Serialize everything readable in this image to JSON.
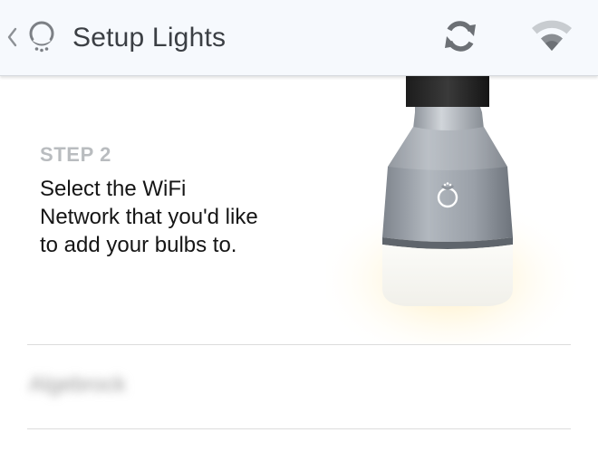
{
  "appbar": {
    "title": "Setup Lights",
    "icons": {
      "back": "chevron-left-icon",
      "logo": "bulb-logo-icon",
      "refresh": "refresh-icon",
      "wifi": "wifi-icon"
    }
  },
  "step": {
    "label": "STEP 2",
    "instruction": "Select the WiFi Network that you'd like to add your bulbs to."
  },
  "networks": [
    {
      "name": "Algebrock"
    }
  ],
  "colors": {
    "appbar_background": "#f6f9fd",
    "title_text": "#3b3f44",
    "step_label": "#b9bcbf",
    "body_text": "#151515",
    "divider": "#dcdcdc",
    "icon_gray": "#6c7075"
  }
}
